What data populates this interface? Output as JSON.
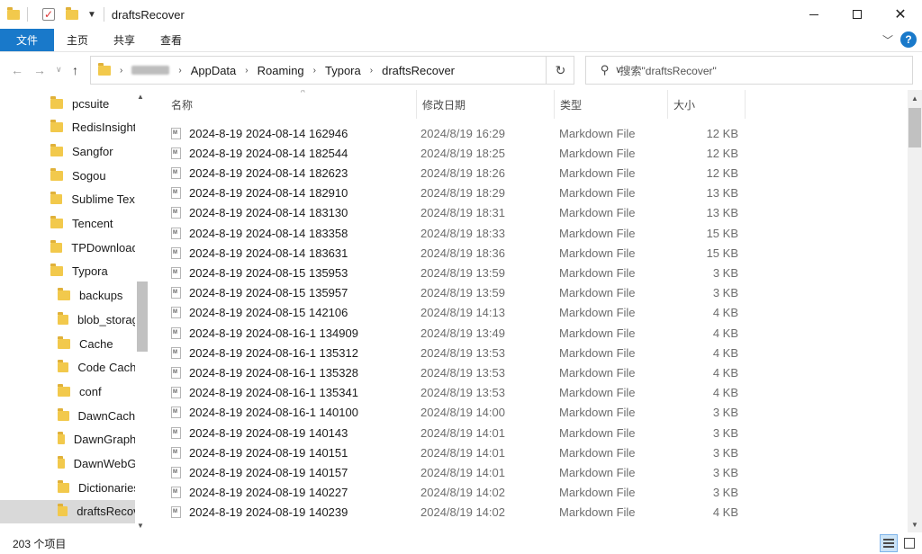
{
  "window": {
    "title": "draftsRecover"
  },
  "ribbon": {
    "tabs": [
      "文件",
      "主页",
      "共享",
      "查看"
    ]
  },
  "address": {
    "crumbs": [
      "AppData",
      "Roaming",
      "Typora",
      "draftsRecover"
    ]
  },
  "search": {
    "placeholder": "搜索\"draftsRecover\""
  },
  "nav": {
    "items": [
      {
        "label": "pcsuite",
        "indent": 0
      },
      {
        "label": "RedisInsight",
        "indent": 0
      },
      {
        "label": "Sangfor",
        "indent": 0
      },
      {
        "label": "Sogou",
        "indent": 0
      },
      {
        "label": "Sublime Text",
        "indent": 0
      },
      {
        "label": "Tencent",
        "indent": 0
      },
      {
        "label": "TPDownload",
        "indent": 0
      },
      {
        "label": "Typora",
        "indent": 0
      },
      {
        "label": "backups",
        "indent": 1
      },
      {
        "label": "blob_storage",
        "indent": 1
      },
      {
        "label": "Cache",
        "indent": 1
      },
      {
        "label": "Code Cache",
        "indent": 1
      },
      {
        "label": "conf",
        "indent": 1
      },
      {
        "label": "DawnCache",
        "indent": 1
      },
      {
        "label": "DawnGraphiteCache",
        "indent": 1
      },
      {
        "label": "DawnWebGPUCache",
        "indent": 1
      },
      {
        "label": "Dictionaries",
        "indent": 1
      },
      {
        "label": "draftsRecover",
        "indent": 1,
        "selected": true
      }
    ]
  },
  "columns": {
    "name": "名称",
    "date": "修改日期",
    "type": "类型",
    "size": "大小"
  },
  "files": [
    {
      "name": "2024-8-19 2024-08-14 162946",
      "date": "2024/8/19 16:29",
      "type": "Markdown File",
      "size": "12 KB"
    },
    {
      "name": "2024-8-19 2024-08-14 182544",
      "date": "2024/8/19 18:25",
      "type": "Markdown File",
      "size": "12 KB"
    },
    {
      "name": "2024-8-19 2024-08-14 182623",
      "date": "2024/8/19 18:26",
      "type": "Markdown File",
      "size": "12 KB"
    },
    {
      "name": "2024-8-19 2024-08-14 182910",
      "date": "2024/8/19 18:29",
      "type": "Markdown File",
      "size": "13 KB"
    },
    {
      "name": "2024-8-19 2024-08-14 183130",
      "date": "2024/8/19 18:31",
      "type": "Markdown File",
      "size": "13 KB"
    },
    {
      "name": "2024-8-19 2024-08-14 183358",
      "date": "2024/8/19 18:33",
      "type": "Markdown File",
      "size": "15 KB"
    },
    {
      "name": "2024-8-19 2024-08-14 183631",
      "date": "2024/8/19 18:36",
      "type": "Markdown File",
      "size": "15 KB"
    },
    {
      "name": "2024-8-19 2024-08-15 135953",
      "date": "2024/8/19 13:59",
      "type": "Markdown File",
      "size": "3 KB"
    },
    {
      "name": "2024-8-19 2024-08-15 135957",
      "date": "2024/8/19 13:59",
      "type": "Markdown File",
      "size": "3 KB"
    },
    {
      "name": "2024-8-19 2024-08-15 142106",
      "date": "2024/8/19 14:13",
      "type": "Markdown File",
      "size": "4 KB"
    },
    {
      "name": "2024-8-19 2024-08-16-1 134909",
      "date": "2024/8/19 13:49",
      "type": "Markdown File",
      "size": "4 KB"
    },
    {
      "name": "2024-8-19 2024-08-16-1 135312",
      "date": "2024/8/19 13:53",
      "type": "Markdown File",
      "size": "4 KB"
    },
    {
      "name": "2024-8-19 2024-08-16-1 135328",
      "date": "2024/8/19 13:53",
      "type": "Markdown File",
      "size": "4 KB"
    },
    {
      "name": "2024-8-19 2024-08-16-1 135341",
      "date": "2024/8/19 13:53",
      "type": "Markdown File",
      "size": "4 KB"
    },
    {
      "name": "2024-8-19 2024-08-16-1 140100",
      "date": "2024/8/19 14:00",
      "type": "Markdown File",
      "size": "3 KB"
    },
    {
      "name": "2024-8-19 2024-08-19 140143",
      "date": "2024/8/19 14:01",
      "type": "Markdown File",
      "size": "3 KB"
    },
    {
      "name": "2024-8-19 2024-08-19 140151",
      "date": "2024/8/19 14:01",
      "type": "Markdown File",
      "size": "3 KB"
    },
    {
      "name": "2024-8-19 2024-08-19 140157",
      "date": "2024/8/19 14:01",
      "type": "Markdown File",
      "size": "3 KB"
    },
    {
      "name": "2024-8-19 2024-08-19 140227",
      "date": "2024/8/19 14:02",
      "type": "Markdown File",
      "size": "3 KB"
    },
    {
      "name": "2024-8-19 2024-08-19 140239",
      "date": "2024/8/19 14:02",
      "type": "Markdown File",
      "size": "4 KB"
    }
  ],
  "status": {
    "item_count": "203 个项目"
  },
  "icons": {
    "folder": "folder-icon",
    "markdown": "markdown-file-icon",
    "search": "search-icon",
    "refresh": "refresh-icon",
    "help": "help-icon"
  },
  "colors": {
    "accent": "#1979ca",
    "folder": "#f2c94c",
    "selection": "#d9d9d9"
  }
}
